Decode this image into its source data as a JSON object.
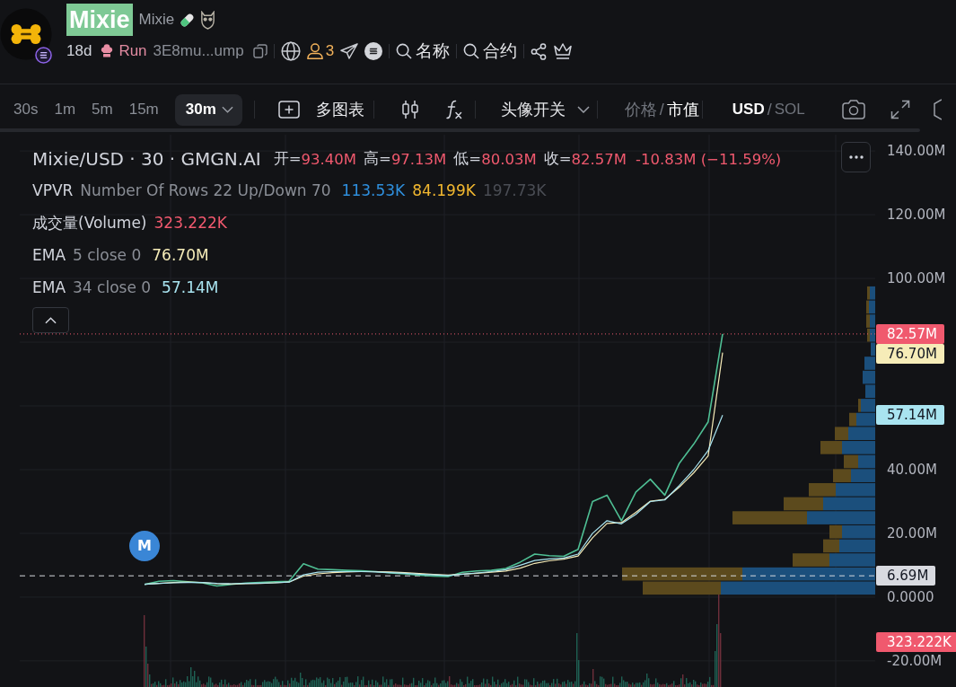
{
  "header": {
    "title": {
      "text": "Mixie",
      "highlighted": true
    },
    "name": "Mixie",
    "age": "18d",
    "status": "Run",
    "address": "3E8mu...ump",
    "holders": "3",
    "search_buttons": [
      {
        "label": "名称"
      },
      {
        "label": "合约"
      }
    ]
  },
  "toolbar": {
    "intervals": [
      {
        "label": "30s",
        "selected": false
      },
      {
        "label": "1m",
        "selected": false
      },
      {
        "label": "5m",
        "selected": false
      },
      {
        "label": "15m",
        "selected": false
      },
      {
        "label": "30m",
        "selected": true
      }
    ],
    "multi_chart": "多图表",
    "avatar_toggle": "头像开关",
    "price_mode": {
      "options": [
        {
          "label": "价格",
          "selected": false
        },
        {
          "label": "市值",
          "selected": true
        }
      ],
      "separator": "/"
    },
    "currency": {
      "options": [
        {
          "label": "USD",
          "selected": true
        },
        {
          "label": "SOL",
          "selected": false
        }
      ],
      "separator": "/"
    }
  },
  "chart": {
    "legend": {
      "symbol": "Mixie/USD · 30 · GMGN.AI",
      "down": true,
      "ohlc": [
        {
          "label": "开=",
          "value": "93.40M"
        },
        {
          "label": "高=",
          "value": "97.13M"
        },
        {
          "label": "低=",
          "value": "80.03M"
        },
        {
          "label": "收=",
          "value": "82.57M"
        }
      ],
      "change": "-10.83M (−11.59%)",
      "indicators": [
        {
          "name": "VPVR",
          "params": "Number Of Rows 22 Up/Down 70",
          "values": [
            {
              "text": "113.53K",
              "color": "#2f8fdd"
            },
            {
              "text": "84.199K",
              "color": "#f2b830"
            },
            {
              "text": "197.73K",
              "color": "#4a4d54"
            }
          ]
        },
        {
          "name": "成交量(Volume)",
          "values": [
            {
              "text": "323.222K",
              "color": "#f0596e"
            }
          ]
        },
        {
          "name": "EMA",
          "params": "5 close 0",
          "values": [
            {
              "text": "76.70M",
              "color": "#f6ecb8"
            }
          ]
        },
        {
          "name": "EMA",
          "params": "34 close 0",
          "values": [
            {
              "text": "57.14M",
              "color": "#a9e4f0"
            }
          ]
        }
      ],
      "expanded": true
    },
    "chart_data": {
      "type": "line",
      "grid": true,
      "ylim": [
        -28.2,
        145.1
      ],
      "yticks": [
        {
          "value": 140,
          "label": "140.00M"
        },
        {
          "value": 120,
          "label": "120.00M"
        },
        {
          "value": 100,
          "label": "100.00M"
        },
        {
          "value": 40,
          "label": "40.00M"
        },
        {
          "value": 20,
          "label": "20.00M"
        },
        {
          "value": 0,
          "label": "0.0000"
        },
        {
          "value": -20,
          "label": "-20.00M"
        }
      ],
      "series": [
        {
          "color": "#4fbf94",
          "values": [
            4.0,
            5.0,
            5.2,
            4.8,
            4.5,
            3.5,
            4.0,
            4.4,
            4.6,
            4.8,
            5.0,
            10.5,
            8.8,
            8.6,
            8.4,
            8.3,
            8.0,
            7.6,
            7.3,
            6.9,
            6.6,
            6.5,
            7.8,
            8.2,
            8.4,
            9.0,
            11.0,
            13.5,
            13.0,
            12.8,
            15.0,
            30.0,
            32.0,
            24.0,
            33.0,
            37.0,
            32.0,
            42.0,
            48.0,
            55.0,
            82.6
          ]
        },
        {
          "color": "#f6ecb8",
          "values": [
            4.0,
            4.3,
            4.6,
            4.7,
            4.6,
            4.2,
            4.1,
            4.2,
            4.3,
            4.5,
            4.7,
            6.6,
            7.3,
            7.7,
            7.9,
            8.0,
            8.0,
            7.9,
            7.7,
            7.4,
            7.1,
            6.9,
            7.2,
            7.5,
            7.8,
            8.2,
            9.1,
            10.6,
            11.4,
            11.9,
            12.9,
            18.6,
            23.1,
            23.4,
            26.6,
            30.1,
            30.7,
            34.5,
            39.0,
            44.3,
            76.7
          ]
        },
        {
          "color": "#a9e4f0",
          "values": [
            4.0,
            4.3,
            4.5,
            4.6,
            4.6,
            4.3,
            4.2,
            4.3,
            4.4,
            4.5,
            4.7,
            7.0,
            7.8,
            8.0,
            8.0,
            8.0,
            7.9,
            7.7,
            7.5,
            7.2,
            7.0,
            6.8,
            7.2,
            7.6,
            8.0,
            8.6,
            10.0,
            11.5,
            12.0,
            12.3,
            13.5,
            20.0,
            24.0,
            23.0,
            26.0,
            30.0,
            30.5,
            35.0,
            40.0,
            46.0,
            57.1
          ]
        }
      ],
      "ref_lines": [
        {
          "axis": "y",
          "value": 82.57,
          "label": "82.57M",
          "color": "#f0596e"
        },
        {
          "axis": "y",
          "value": 6.69,
          "label": "6.69M",
          "color": "#d8dae0"
        }
      ],
      "annotations": [
        "76.70M",
        "57.14M"
      ]
    },
    "marker_label": "M",
    "volume_label": {
      "text": "323.222K",
      "color": "#f0596e"
    }
  }
}
